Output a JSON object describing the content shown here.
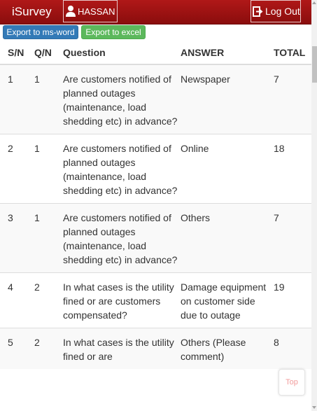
{
  "app": {
    "brand": "iSurvey",
    "user_name": "HASSAN",
    "logout_label": "Log Out"
  },
  "toolbar": {
    "export_word_label": "Export to ms-word",
    "export_excel_label": "Export to excel"
  },
  "table": {
    "headers": {
      "sn": "S/N",
      "qn": "Q/N",
      "question": "Question",
      "answer": "ANSWER",
      "total": "TOTAL"
    },
    "rows": [
      {
        "sn": "1",
        "qn": "1",
        "question": "Are customers notified of planned outages (maintenance, load shedding etc) in advance?",
        "answer": "Newspaper",
        "total": "7"
      },
      {
        "sn": "2",
        "qn": "1",
        "question": "Are customers notified of planned outages (maintenance, load shedding etc) in advance?",
        "answer": "Online",
        "total": "18"
      },
      {
        "sn": "3",
        "qn": "1",
        "question": "Are customers notified of planned outages (maintenance, load shedding etc) in advance?",
        "answer": "Others",
        "total": "7"
      },
      {
        "sn": "4",
        "qn": "2",
        "question": "In what cases is the utility fined or are customers compensated?",
        "answer": "Damage equipment on customer side due to outage",
        "total": "19"
      },
      {
        "sn": "5",
        "qn": "2",
        "question": "In what cases is the utility fined or are",
        "answer": "Others (Please comment)",
        "total": "8"
      }
    ]
  },
  "back_to_top_label": "Top",
  "colors": {
    "header_bg": "#9e1212",
    "export_word_bg": "#337ab7",
    "export_excel_bg": "#5cb85c",
    "stripe_bg": "#f9f9f9"
  },
  "icons": {
    "user": "user-icon",
    "logout": "logout-icon"
  }
}
